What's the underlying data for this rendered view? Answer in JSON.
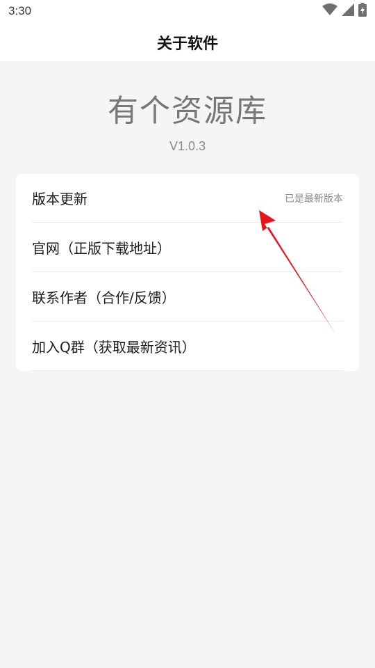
{
  "status_bar": {
    "time": "3:30",
    "icons": [
      "wifi-icon",
      "cell-signal-icon",
      "battery-icon"
    ]
  },
  "app_bar": {
    "title": "关于软件"
  },
  "hero": {
    "app_name": "有个资源库",
    "version": "V1.0.3"
  },
  "menu": {
    "items": [
      {
        "label": "版本更新",
        "value": "已是最新版本"
      },
      {
        "label": "官网（正版下载地址）",
        "value": ""
      },
      {
        "label": "联系作者（合作/反馈）",
        "value": ""
      },
      {
        "label": "加入Q群（获取最新资讯）",
        "value": ""
      }
    ]
  },
  "colors": {
    "annotation_arrow": "#e8141b"
  }
}
